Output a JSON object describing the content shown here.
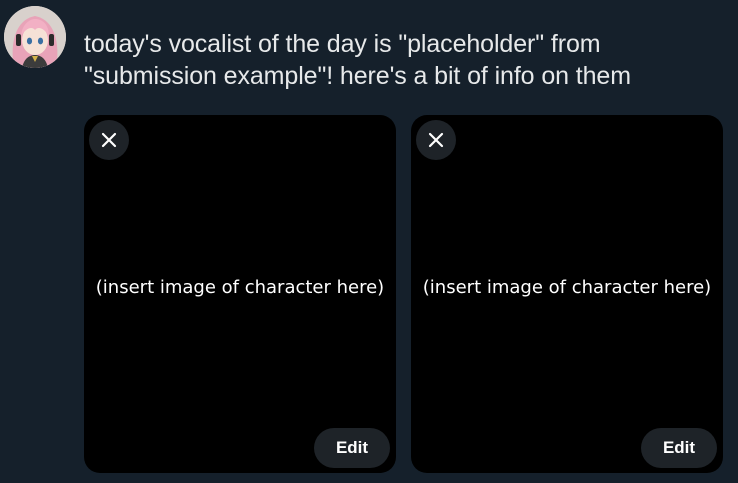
{
  "composer": {
    "avatar_icon": "user-avatar-pink-hair-character",
    "post_text": "today's vocalist of the day is \"placeholder\" from\n\"submission example\"! here's a bit of info on them"
  },
  "media": [
    {
      "placeholder": "(insert image of character here)",
      "remove_icon": "close-icon",
      "edit_label": "Edit"
    },
    {
      "placeholder": "(insert image of character here)",
      "remove_icon": "close-icon",
      "edit_label": "Edit"
    }
  ],
  "colors": {
    "background": "#15202b",
    "text": "#e7e9ea",
    "media_background": "#000000",
    "overlay_button": "#1e2328"
  }
}
